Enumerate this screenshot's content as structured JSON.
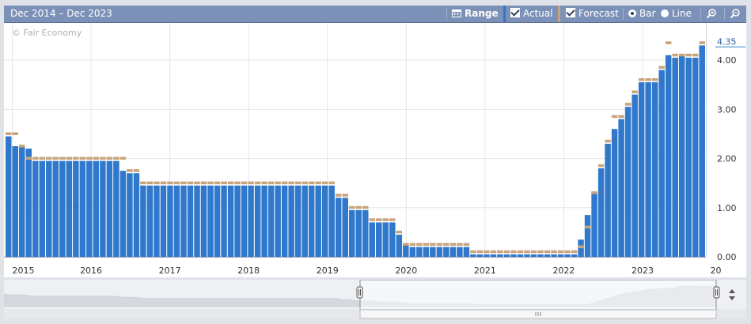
{
  "toolbar": {
    "range_text": "Dec 2014 – Dec 2023",
    "range_button": "Range",
    "actual_label": "Actual",
    "forecast_label": "Forecast",
    "bar_label": "Bar",
    "line_label": "Line"
  },
  "watermark": "© Fair Economy",
  "colors": {
    "actual": "#2f78cc",
    "forecast": "#c9a37a",
    "toolbar": "#7c91b8",
    "grid": "#e6e6e6"
  },
  "chart_data": {
    "type": "bar",
    "ylim": [
      0,
      4.5
    ],
    "y_ticks": [
      "0.00",
      "1.00",
      "2.00",
      "3.00",
      "4.00"
    ],
    "x_tick_labels": [
      "2015",
      "2016",
      "2017",
      "2018",
      "2019",
      "2020",
      "2021",
      "2022",
      "2023",
      "20"
    ],
    "last_value_label": "4.35",
    "series": [
      {
        "values": [
          2.45,
          2.25,
          2.25,
          2.2,
          1.95,
          1.95,
          1.95,
          1.95,
          1.95,
          1.95,
          1.95,
          1.95,
          1.95,
          1.95,
          1.95,
          1.95,
          1.95,
          1.75,
          1.7,
          1.7,
          1.45,
          1.45,
          1.45,
          1.45,
          1.45,
          1.45,
          1.45,
          1.45,
          1.45,
          1.45,
          1.45,
          1.45,
          1.45,
          1.45,
          1.45,
          1.45,
          1.45,
          1.45,
          1.45,
          1.45,
          1.45,
          1.45,
          1.45,
          1.45,
          1.45,
          1.45,
          1.45,
          1.45,
          1.45,
          1.2,
          1.2,
          0.95,
          0.95,
          0.95,
          0.7,
          0.7,
          0.7,
          0.7,
          0.45,
          0.25,
          0.2,
          0.2,
          0.2,
          0.2,
          0.2,
          0.2,
          0.2,
          0.2,
          0.2,
          0.05,
          0.05,
          0.05,
          0.05,
          0.05,
          0.05,
          0.05,
          0.05,
          0.05,
          0.05,
          0.05,
          0.05,
          0.05,
          0.05,
          0.05,
          0.05,
          0.35,
          0.85,
          1.3,
          1.8,
          2.3,
          2.6,
          2.8,
          3.05,
          3.3,
          3.55,
          3.55,
          3.55,
          3.8,
          4.1,
          4.05,
          4.1,
          4.05,
          4.05,
          4.3
        ]
      },
      {
        "values": [
          2.5,
          2.5,
          2.25,
          2.0,
          2.0,
          2.0,
          2.0,
          2.0,
          2.0,
          2.0,
          2.0,
          2.0,
          2.0,
          2.0,
          2.0,
          2.0,
          2.0,
          2.0,
          1.75,
          1.75,
          1.5,
          1.5,
          1.5,
          1.5,
          1.5,
          1.5,
          1.5,
          1.5,
          1.5,
          1.5,
          1.5,
          1.5,
          1.5,
          1.5,
          1.5,
          1.5,
          1.5,
          1.5,
          1.5,
          1.5,
          1.5,
          1.5,
          1.5,
          1.5,
          1.5,
          1.5,
          1.5,
          1.5,
          1.5,
          1.25,
          1.25,
          1.0,
          1.0,
          1.0,
          0.75,
          0.75,
          0.75,
          0.75,
          0.5,
          0.25,
          0.25,
          0.25,
          0.25,
          0.25,
          0.25,
          0.25,
          0.25,
          0.25,
          0.25,
          0.1,
          0.1,
          0.1,
          0.1,
          0.1,
          0.1,
          0.1,
          0.1,
          0.1,
          0.1,
          0.1,
          0.1,
          0.1,
          0.1,
          0.1,
          0.1,
          0.2,
          0.6,
          1.3,
          1.85,
          2.35,
          2.85,
          2.85,
          3.1,
          3.35,
          3.6,
          3.6,
          3.6,
          3.85,
          4.35,
          4.1,
          4.1,
          4.1,
          4.1,
          4.35
        ]
      }
    ]
  }
}
